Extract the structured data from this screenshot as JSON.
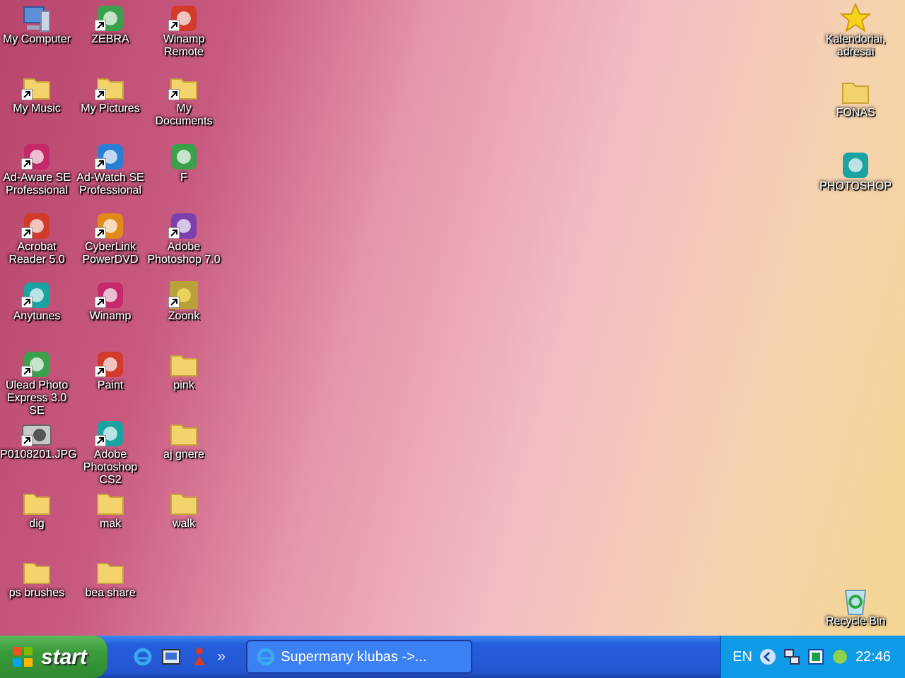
{
  "desktop": {
    "left_rows": [
      [
        {
          "label": "My Computer",
          "kind": "computer",
          "shortcut": false
        },
        {
          "label": "ZEBRA",
          "kind": "app",
          "shortcut": true
        },
        {
          "label": "Winamp Remote",
          "kind": "app",
          "shortcut": true
        }
      ],
      [
        {
          "label": "My Music",
          "kind": "folder",
          "shortcut": true
        },
        {
          "label": "My Pictures",
          "kind": "folder",
          "shortcut": true
        },
        {
          "label": "My Documents",
          "kind": "folder",
          "shortcut": true
        }
      ],
      [
        {
          "label": "Ad-Aware SE Professional",
          "kind": "app",
          "shortcut": true
        },
        {
          "label": "Ad-Watch SE Professional",
          "kind": "app",
          "shortcut": true
        },
        {
          "label": "F",
          "kind": "app",
          "shortcut": false
        }
      ],
      [
        {
          "label": "Acrobat Reader 5.0",
          "kind": "app",
          "shortcut": true
        },
        {
          "label": "CyberLink PowerDVD",
          "kind": "app",
          "shortcut": true
        },
        {
          "label": "Adobe Photoshop 7.0",
          "kind": "app",
          "shortcut": true
        }
      ],
      [
        {
          "label": "Anytunes",
          "kind": "app",
          "shortcut": true
        },
        {
          "label": "Winamp",
          "kind": "app",
          "shortcut": true
        },
        {
          "label": "Zoonk",
          "kind": "image",
          "shortcut": true
        }
      ],
      [
        {
          "label": "Ulead Photo Express 3.0 SE",
          "kind": "app",
          "shortcut": true
        },
        {
          "label": "Paint",
          "kind": "app",
          "shortcut": true
        },
        {
          "label": "pink",
          "kind": "folder",
          "shortcut": false
        }
      ],
      [
        {
          "label": "P0108201.JPG",
          "kind": "camera",
          "shortcut": true
        },
        {
          "label": "Adobe Photoshop CS2",
          "kind": "app",
          "shortcut": true
        },
        {
          "label": "aj gnere",
          "kind": "folder",
          "shortcut": false
        }
      ],
      [
        {
          "label": "dig",
          "kind": "folder",
          "shortcut": false
        },
        {
          "label": "mak",
          "kind": "folder",
          "shortcut": false
        },
        {
          "label": "walk",
          "kind": "folder",
          "shortcut": false
        }
      ],
      [
        {
          "label": "ps brushes",
          "kind": "folder",
          "shortcut": false
        },
        {
          "label": "bea share",
          "kind": "folder",
          "shortcut": false
        }
      ]
    ],
    "right_icons": [
      {
        "label": "Kalendoriai, adresai",
        "kind": "star",
        "shortcut": false
      },
      {
        "label": "FONAS",
        "kind": "folder",
        "shortcut": false
      },
      {
        "label": "PHOTOSHOP",
        "kind": "app",
        "shortcut": false
      }
    ],
    "recycle_bin": {
      "label": "Recycle Bin",
      "kind": "recycle",
      "shortcut": false
    }
  },
  "taskbar": {
    "start": "start",
    "chevron": "»",
    "tasks": [
      {
        "label": "Supermany klubas ->...",
        "selected": false
      }
    ],
    "tray": {
      "language": "EN",
      "clock": "22:46"
    }
  }
}
